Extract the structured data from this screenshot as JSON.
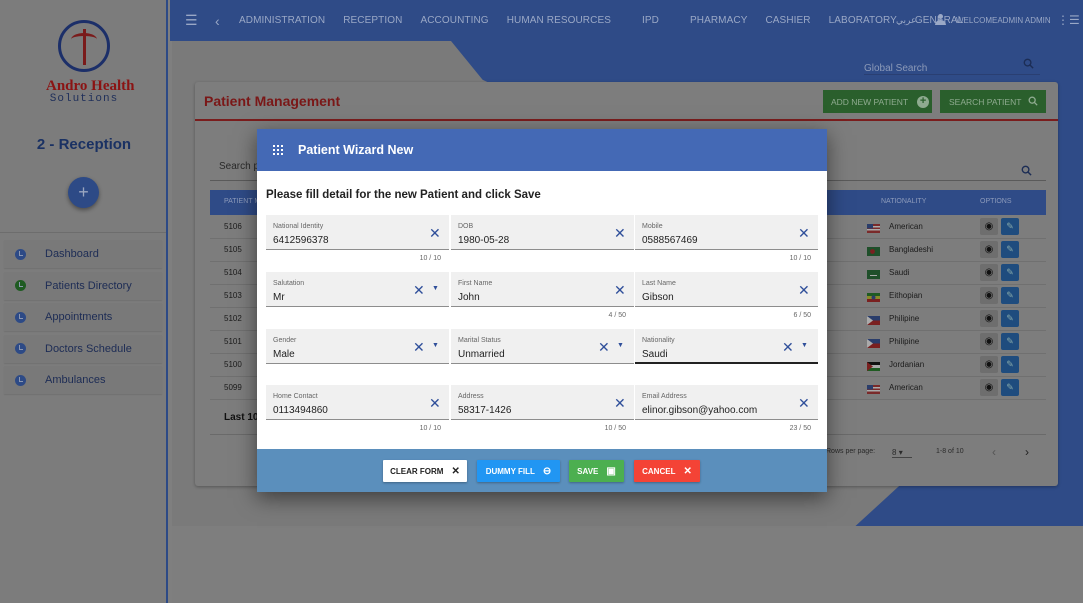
{
  "sidebar": {
    "brand": "Andro Health",
    "brand_sub": "Solutions",
    "department": "2 - Reception",
    "add_button": "+",
    "items": [
      {
        "label": "Dashboard",
        "icon": "clock-icon"
      },
      {
        "label": "Patients Directory",
        "icon": "clock-icon"
      },
      {
        "label": "Appointments",
        "icon": "clock-icon"
      },
      {
        "label": "Doctors Schedule",
        "icon": "clock-icon"
      },
      {
        "label": "Ambulances",
        "icon": "clock-icon"
      }
    ]
  },
  "topbar": {
    "nav": [
      "ADMINISTRATION",
      "RECEPTION",
      "ACCOUNTING",
      "HUMAN RESOURCES",
      "IPD",
      "PHARMACY",
      "CASHIER",
      "LABORATORY",
      "GENERAL"
    ],
    "language": "عربي",
    "user": "WELCOMEADMIN ADMIN"
  },
  "global_search": {
    "placeholder": "Global Search"
  },
  "page": {
    "title": "Patient Management",
    "add_new_patient": "ADD NEW PATIENT",
    "search_patient": "SEARCH PATIENT",
    "patient_search_placeholder": "Search p",
    "columns": {
      "patient": "PATIENT M",
      "nationality": "NATIONALITY",
      "options": "OPTIONS"
    },
    "rows": [
      {
        "id": "5106",
        "nationality": "American"
      },
      {
        "id": "5105",
        "nationality": "Bangladeshi"
      },
      {
        "id": "5104",
        "nationality": "Saudi"
      },
      {
        "id": "5103",
        "nationality": "Eithopian"
      },
      {
        "id": "5102",
        "nationality": "Philipine"
      },
      {
        "id": "5101",
        "nationality": "Philipine"
      },
      {
        "id": "5100",
        "nationality": "Jordanian"
      },
      {
        "id": "5099",
        "nationality": "American"
      }
    ],
    "last_ten": "Last 10",
    "rows_per_page_label": "Rows per page:",
    "rows_per_page": "8",
    "range": "1-8 of 10"
  },
  "modal": {
    "title": "Patient Wizard New",
    "subtitle": "Please fill detail for the new Patient and click Save",
    "fields": {
      "national_identity": {
        "label": "National Identity",
        "value": "6412596378",
        "counter": "10 / 10"
      },
      "dob": {
        "label": "DOB",
        "value": "1980-05-28"
      },
      "mobile": {
        "label": "Mobile",
        "value": "0588567469",
        "counter": "10 / 10"
      },
      "salutation": {
        "label": "Salutation",
        "value": "Mr"
      },
      "first_name": {
        "label": "First Name",
        "value": "John",
        "counter": "4 / 50"
      },
      "last_name": {
        "label": "Last Name",
        "value": "Gibson",
        "counter": "6 / 50"
      },
      "gender": {
        "label": "Gender",
        "value": "Male"
      },
      "marital_status": {
        "label": "Marital Status",
        "value": "Unmarried"
      },
      "nationality": {
        "label": "Nationality",
        "value": "Saudi"
      },
      "home_contact": {
        "label": "Home Contact",
        "value": "0113494860",
        "counter": "10 / 10"
      },
      "address": {
        "label": "Address",
        "value": "58317-1426",
        "counter": "10 / 50"
      },
      "email": {
        "label": "Email Address",
        "value": "elinor.gibson@yahoo.com",
        "counter": "23 / 50"
      }
    },
    "buttons": {
      "clear_form": "CLEAR FORM",
      "dummy_fill": "DUMMY FILL",
      "save": "SAVE",
      "cancel": "CANCEL"
    }
  },
  "colors": {
    "primary": "#2f4b87",
    "modal_header": "#4469b5",
    "modal_footer": "#5b8fbc",
    "save": "#4caf50",
    "cancel": "#f44336",
    "dummy": "#2196f3",
    "title_red": "#7a1717"
  }
}
